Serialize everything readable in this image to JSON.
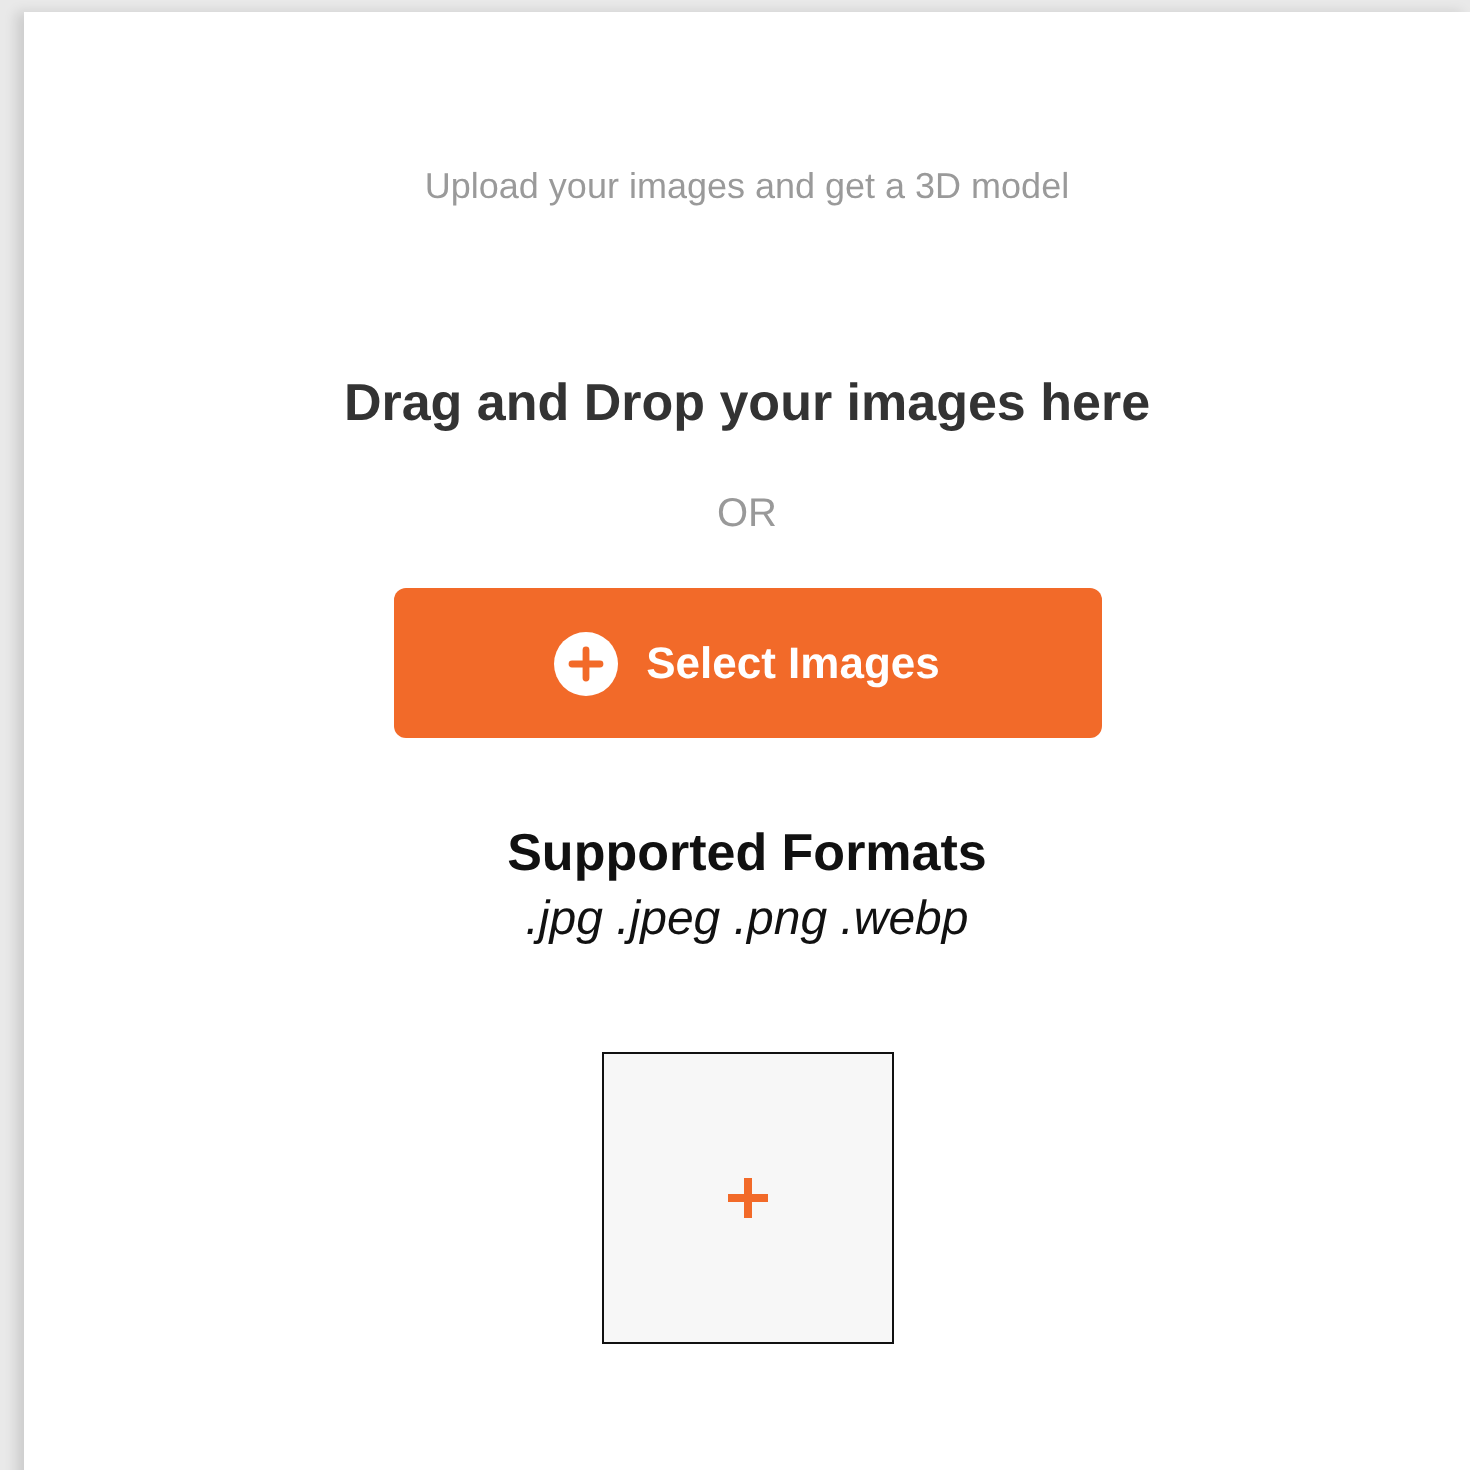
{
  "subtitle": "Upload your images and get a 3D model",
  "heading": "Drag and Drop your images here",
  "separator": "OR",
  "select_button": {
    "label": "Select Images"
  },
  "formats": {
    "title": "Supported Formats",
    "list": ".jpg .jpeg .png .webp"
  },
  "add_tile": {
    "kind": "add"
  }
}
